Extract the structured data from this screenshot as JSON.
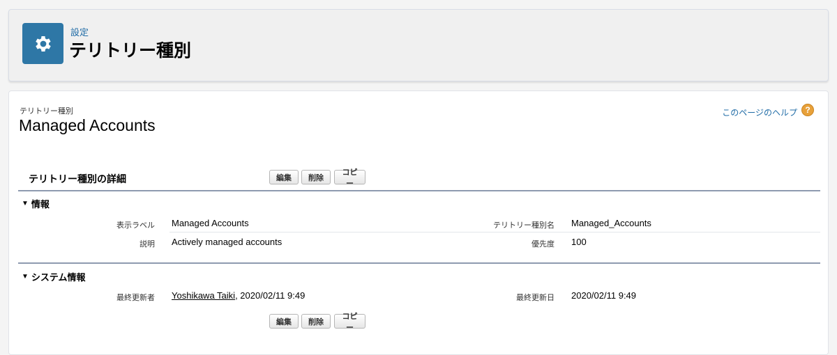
{
  "header": {
    "breadcrumb": "設定",
    "title": "テリトリー種別",
    "icon": "gear-icon",
    "icon_color": "#2e77a6"
  },
  "record": {
    "type_label": "テリトリー種別",
    "name": "Managed Accounts"
  },
  "help": {
    "link_text": "このページのヘルプ",
    "icon_glyph": "?"
  },
  "detail": {
    "section_title": "テリトリー種別の詳細",
    "buttons": {
      "edit": "編集",
      "delete": "削除",
      "copy": "コピー"
    }
  },
  "info": {
    "section_title": "情報",
    "fields": {
      "display_label": {
        "label": "表示ラベル",
        "value": "Managed Accounts"
      },
      "api_name": {
        "label": "テリトリー種別名",
        "value": "Managed_Accounts"
      },
      "description": {
        "label": "説明",
        "value": "Actively managed accounts"
      },
      "priority": {
        "label": "優先度",
        "value": "100"
      }
    }
  },
  "system_info": {
    "section_title": "システム情報",
    "last_modified_by": {
      "label": "最終更新者",
      "user": "Yoshikawa Taiki",
      "date": ", 2020/02/11 9:49"
    },
    "last_modified_date": {
      "label": "最終更新日",
      "value": "2020/02/11 9:49"
    }
  },
  "toggle_glyph": "▼"
}
